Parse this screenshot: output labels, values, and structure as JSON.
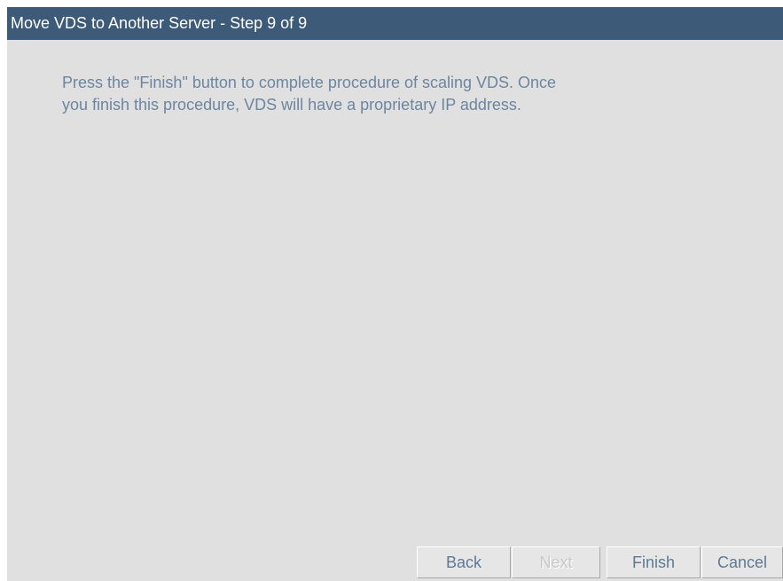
{
  "dialog": {
    "title": "Move VDS to Another Server - Step 9 of 9",
    "message_line_1": "Press the \"Finish\" button to complete procedure of scaling VDS. Once",
    "message_line_2": "you finish this procedure, VDS will have a proprietary IP address."
  },
  "buttons": {
    "back_label": "Back",
    "next_label": "Next",
    "next_disabled": true,
    "finish_label": "Finish",
    "cancel_label": "Cancel"
  },
  "colors": {
    "titlebar_bg": "#3d5a78",
    "dialog_bg": "#e0e0e0",
    "text": "#6c86a0"
  }
}
